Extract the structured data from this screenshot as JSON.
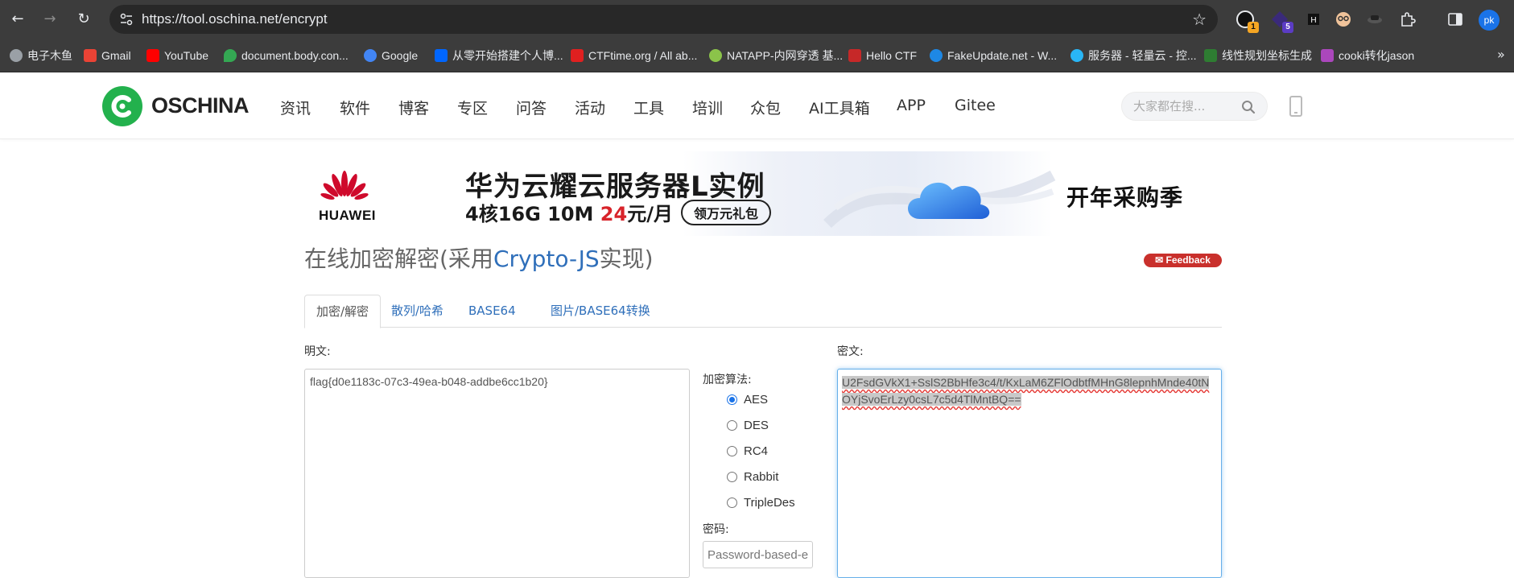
{
  "browser": {
    "url": "https://tool.oschina.net/encrypt",
    "profile_initials": "pk",
    "extensions": [
      {
        "name": "extension-1",
        "badge": "1",
        "badge_color": "#f5a623"
      },
      {
        "name": "extension-2",
        "badge": "5",
        "badge_color": "#5b3cc4"
      }
    ],
    "bookmarks": [
      {
        "label": "电子木鱼",
        "color": "#9aa0a6"
      },
      {
        "label": "Gmail",
        "color": "#ea4335"
      },
      {
        "label": "YouTube",
        "color": "#ff0000"
      },
      {
        "label": "document.body.con...",
        "color": "#34a853"
      },
      {
        "label": "Google",
        "color": "#4285f4"
      },
      {
        "label": "从零开始搭建个人博...",
        "color": "#0066ff"
      },
      {
        "label": "CTFtime.org / All ab...",
        "color": "#e02020"
      },
      {
        "label": "NATAPP-内网穿透 基...",
        "color": "#8bc34a"
      },
      {
        "label": "Hello CTF",
        "color": "#c62828"
      },
      {
        "label": "FakeUpdate.net - W...",
        "color": "#1e88e5"
      },
      {
        "label": "服务器 - 轻量云 - 控...",
        "color": "#29b6f6"
      },
      {
        "label": "线性规划坐标生成",
        "color": "#2e7d32"
      },
      {
        "label": "cooki转化jason",
        "color": "#ab47bc"
      }
    ]
  },
  "site": {
    "logo_text": "OSCHINA",
    "brand_color": "#23b14d",
    "nav": [
      "资讯",
      "软件",
      "博客",
      "专区",
      "问答",
      "活动",
      "工具",
      "培训",
      "众包",
      "AI工具箱",
      "APP",
      "Gitee"
    ],
    "search_placeholder": "大家都在搜..."
  },
  "banner": {
    "brand": "HUAWEI",
    "headline": "华为云耀云服务器L实例",
    "sub_prefix": "4核16G 10M ",
    "price": "24",
    "price_unit": "元/月",
    "pill": "领万元礼包",
    "right_text": "开年采购季"
  },
  "page": {
    "title_prefix": "在线加密解密(采用",
    "title_link": "Crypto-JS",
    "title_suffix": "实现)",
    "feedback": "Feedback",
    "tabs": [
      "加密/解密",
      "散列/哈希",
      "BASE64",
      "图片/BASE64转换"
    ]
  },
  "form": {
    "plaintext_label": "明文:",
    "plaintext_value": "flag{d0e1183c-07c3-49ea-b048-addbe6cc1b20}",
    "algo_label": "加密算法:",
    "algorithms": [
      "AES",
      "DES",
      "RC4",
      "Rabbit",
      "TripleDes"
    ],
    "selected_algorithm": "AES",
    "password_label": "密码:",
    "password_placeholder": "Password-based-encryption",
    "ciphertext_label": "密文:",
    "ciphertext_value": "U2FsdGVkX1+SslS2BbHfe3c4/t/KxLaM6ZFlOdbtfMHnG8lepnhMnde40tNOYjSvoErLzy0csL7c5d4TlMntBQ=="
  }
}
